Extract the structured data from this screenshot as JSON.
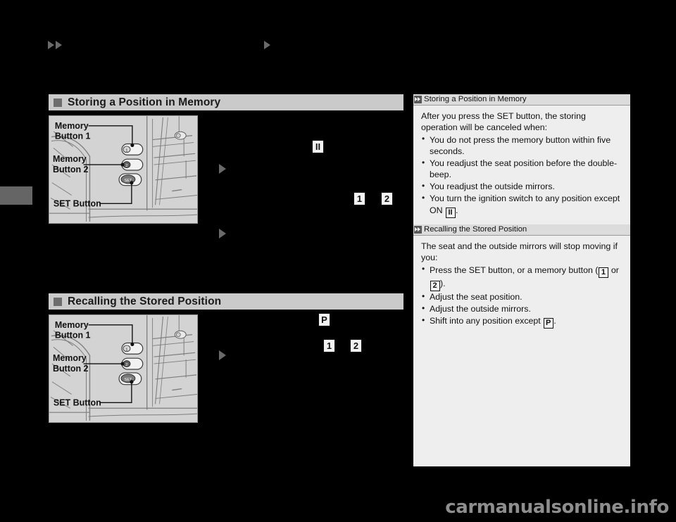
{
  "page": {
    "background_color": "#000000",
    "watermark": "carmanualsonline.info"
  },
  "top_markers": {
    "left_arrows_icon": "double-triangle-right-icon",
    "mid_arrow_icon": "triangle-right-icon"
  },
  "edge_tab": {
    "name": "page-edge-tab",
    "color": "#656565"
  },
  "sections": [
    {
      "id": "storing",
      "heading": "Storing a Position in Memory",
      "bullet_color": "#6d6d6d",
      "header_bg": "#cacaca",
      "illustration": {
        "name": "memory-buttons-illustration",
        "background": "#d3d3d3",
        "labels": [
          "Memory",
          "Button 1",
          "Memory",
          "Button 2",
          "SET Button"
        ]
      },
      "inline_keys": [
        {
          "label": "II",
          "name": "key-ignition-on"
        },
        {
          "label": "1",
          "name": "key-memory-1"
        },
        {
          "label": "2",
          "name": "key-memory-2"
        }
      ],
      "step_arrows": 2
    },
    {
      "id": "recalling",
      "heading": "Recalling the Stored Position",
      "bullet_color": "#6d6d6d",
      "header_bg": "#cacaca",
      "illustration": {
        "name": "memory-buttons-illustration",
        "background": "#d3d3d3",
        "labels": [
          "Memory",
          "Button 1",
          "Memory",
          "Button 2",
          "SET Button"
        ]
      },
      "inline_keys": [
        {
          "label": "P",
          "name": "key-shift-park"
        },
        {
          "label": "1",
          "name": "key-memory-1"
        },
        {
          "label": "2",
          "name": "key-memory-2"
        }
      ],
      "step_arrows": 1
    }
  ],
  "sidebar": {
    "background": "#eeeeee",
    "notes": [
      {
        "title": "Storing a Position in Memory",
        "intro": "After you press the SET button, the storing operation will be canceled when:",
        "bullets": [
          {
            "text_before": "You do not press the memory button within five seconds.",
            "key": "",
            "text_after": ""
          },
          {
            "text_before": "You readjust the seat position before the double-beep.",
            "key": "",
            "text_after": ""
          },
          {
            "text_before": "You readjust the outside mirrors.",
            "key": "",
            "text_after": ""
          },
          {
            "text_before": "You turn the ignition switch to any position except ON ",
            "key": "II",
            "text_after": "."
          }
        ]
      },
      {
        "title": "Recalling the Stored Position",
        "intro": "The seat and the outside mirrors will stop moving if you:",
        "bullets": [
          {
            "text_before": "Press the SET button, or a memory button (",
            "key": "1",
            "mid": " or ",
            "key2": "2",
            "text_after": ")."
          },
          {
            "text_before": "Adjust the seat position.",
            "key": "",
            "text_after": ""
          },
          {
            "text_before": "Adjust the outside mirrors.",
            "key": "",
            "text_after": ""
          },
          {
            "text_before": "Shift into any position except ",
            "key": "P",
            "text_after": "."
          }
        ]
      }
    ]
  }
}
